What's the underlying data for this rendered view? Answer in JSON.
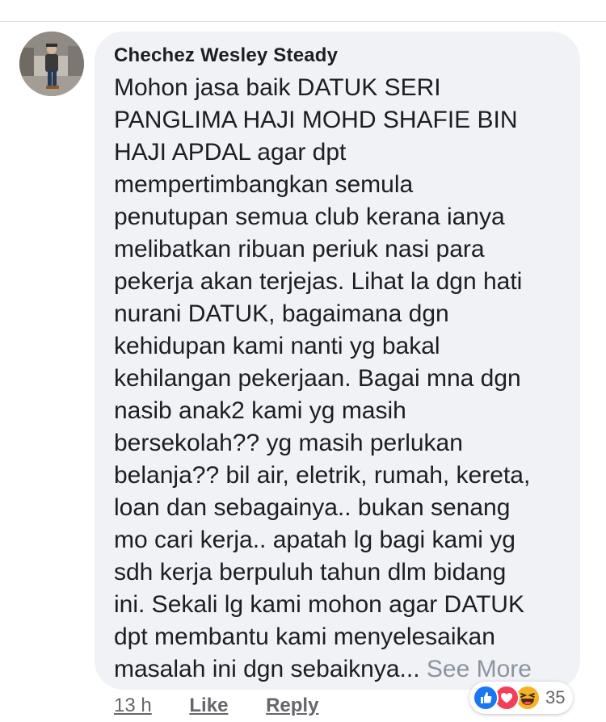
{
  "comment": {
    "author": "Chechez Wesley Steady",
    "body_lines": [
      "Mohon jasa baik DATUK SERI",
      "PANGLIMA HAJI MOHD SHAFIE BIN",
      "HAJI APDAL agar dpt",
      "mempertimbangkan semula",
      "penutupan semua club kerana ianya",
      "melibatkan ribuan periuk nasi para",
      "pekerja akan terjejas. Lihat la dgn hati",
      "nurani DATUK, bagaimana dgn",
      "kehidupan kami nanti yg bakal",
      "kehilangan pekerjaan. Bagai mna dgn",
      "nasib anak2 kami yg masih",
      "bersekolah?? yg masih perlukan",
      "belanja?? bil air, eletrik, rumah, kereta,",
      "loan dan sebagainya.. bukan senang",
      "mo cari kerja.. apatah lg bagi kami yg",
      "sdh kerja berpuluh tahun dlm bidang",
      "ini. Sekali lg kami mohon agar DATUK",
      "dpt membantu kami menyelesaikan"
    ],
    "last_line": "masalah ini dgn sebaiknya...",
    "see_more": "See More",
    "time": "13 h",
    "like_label": "Like",
    "reply_label": "Reply",
    "reactions": {
      "icons": [
        "like-icon",
        "love-icon",
        "haha-icon"
      ],
      "count": "35"
    }
  },
  "colors": {
    "bubble": "#f0f2f5",
    "text": "#1c1e21",
    "meta": "#65676b",
    "see_more": "#8d949e",
    "like": "#1877f2",
    "love": "#f33e58",
    "haha": "#f7b125"
  }
}
